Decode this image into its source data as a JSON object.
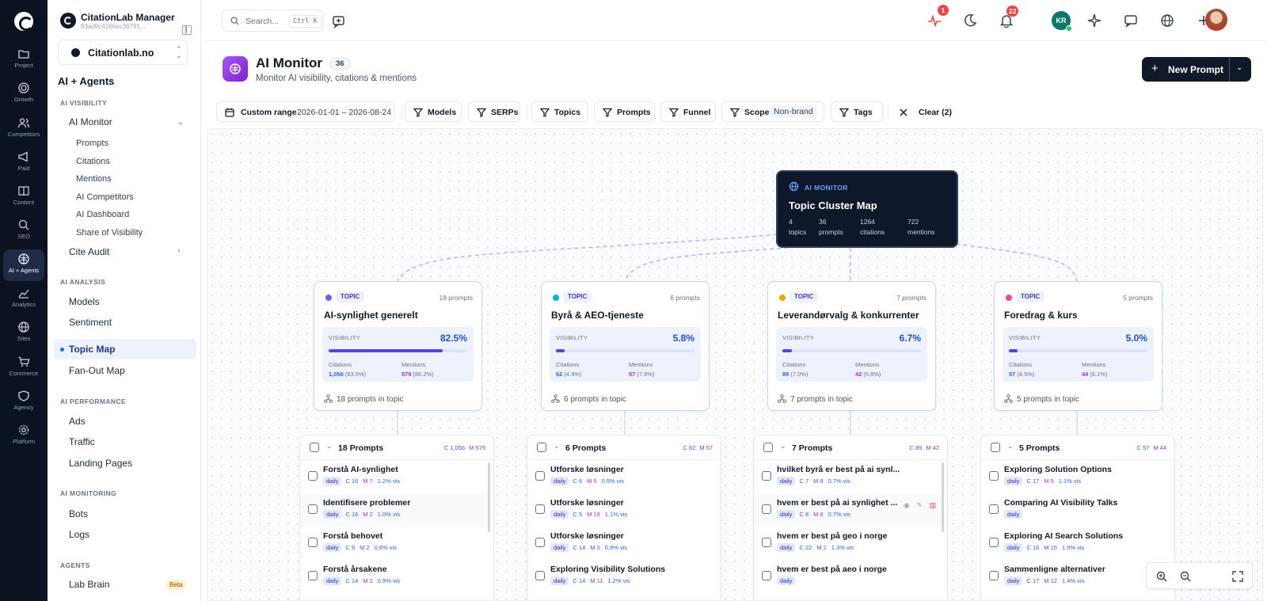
{
  "rail": [
    {
      "label": "Project",
      "icon": "folder-icon"
    },
    {
      "label": "Growth",
      "icon": "target-icon"
    },
    {
      "label": "Competitors",
      "icon": "users-icon"
    },
    {
      "label": "Paid",
      "icon": "megaphone-icon"
    },
    {
      "label": "Content",
      "icon": "book-icon"
    },
    {
      "label": "SEO",
      "icon": "search-icon"
    },
    {
      "label": "AI + Agents",
      "icon": "ai-icon"
    },
    {
      "label": "Analytics",
      "icon": "chart-icon"
    },
    {
      "label": "Sites",
      "icon": "globe-icon"
    },
    {
      "label": "Commerce",
      "icon": "cart-icon"
    },
    {
      "label": "Agency",
      "icon": "handshake-icon"
    },
    {
      "label": "Platform",
      "icon": "gear-icon"
    }
  ],
  "brand": {
    "name": "CitationLab Manager",
    "id": "93ad9c4166ec36791..."
  },
  "workspace": "Citationlab.no",
  "section": "AI + Agents",
  "nav": {
    "ai_visibility": "AI VISIBILITY",
    "ai_monitor": "AI Monitor",
    "monitor_subs": [
      "Prompts",
      "Citations",
      "Mentions",
      "AI Competitors",
      "AI Dashboard",
      "Share of Visibility"
    ],
    "cite_audit": "Cite Audit",
    "ai_analysis": "AI ANALYSIS",
    "models": "Models",
    "sentiment": "Sentiment",
    "topic_map": "Topic Map",
    "fanout": "Fan-Out Map",
    "ai_performance": "AI PERFORMANCE",
    "ads": "Ads",
    "traffic": "Traffic",
    "landing": "Landing Pages",
    "ai_monitoring": "AI MONITORING",
    "bots": "Bots",
    "logs": "Logs",
    "agents": "AGENTS",
    "lab_brain": "Lab Brain",
    "beta": "Beta"
  },
  "topbar": {
    "search_placeholder": "Search...",
    "shortcut": "Ctrl K",
    "activity_badge": "1",
    "notif_badge": "22",
    "avatar_initials": "KR"
  },
  "page": {
    "title": "AI Monitor",
    "count": "36",
    "subtitle": "Monitor AI visibility, citations & mentions",
    "new_prompt": "New Prompt"
  },
  "filters": {
    "range_label": "Custom range",
    "range_value": "2026-01-01 – 2026-08-24",
    "models": "Models",
    "serps": "SERPs",
    "topics": "Topics",
    "prompts": "Prompts",
    "funnel": "Funnel",
    "scope": "Scope",
    "scope_value": "Non-brand",
    "tags": "Tags",
    "clear": "Clear (2)"
  },
  "root": {
    "tag": "AI MONITOR",
    "title": "Topic Cluster Map",
    "stats": [
      {
        "v": "4",
        "l": "topics"
      },
      {
        "v": "36",
        "l": "prompts"
      },
      {
        "v": "1264",
        "l": "citations"
      },
      {
        "v": "722",
        "l": "mentions"
      }
    ]
  },
  "topics": [
    {
      "tag": "TOPIC",
      "dot": "#6366f1",
      "count": "18 prompts",
      "name": "AI-synlighet generelt",
      "vis_label": "VISIBILITY",
      "vis": "82.5%",
      "fill": 0.825,
      "cit_label": "Citations",
      "cit": "1,056",
      "cit_pct": "(83.5%)",
      "men_label": "Mentions",
      "men": "579",
      "men_pct": "(80.2%)",
      "footer": "18 prompts in topic",
      "list": {
        "header": "18 Prompts",
        "c": "C 1,056",
        "m": "M 579",
        "rows": [
          {
            "title": "Forstå AI-synlighet",
            "freq": "daily",
            "c": "C 16",
            "m": "M 7",
            "v": "1.2% vis"
          },
          {
            "title": "Identifisere problemer",
            "freq": "daily",
            "c": "C 16",
            "m": "M 2",
            "v": "1.0% vis"
          },
          {
            "title": "Forstå behovet",
            "freq": "daily",
            "c": "C 9",
            "m": "M 2",
            "v": "0.6% vis"
          },
          {
            "title": "Forstå årsakene",
            "freq": "daily",
            "c": "C 14",
            "m": "M 2",
            "v": "0.9% vis"
          }
        ]
      }
    },
    {
      "tag": "TOPIC",
      "dot": "#06b6d4",
      "count": "6 prompts",
      "name": "Byrå & AEO-tjeneste",
      "vis_label": "VISIBILITY",
      "vis": "5.8%",
      "fill": 0.058,
      "cit_label": "Citations",
      "cit": "62",
      "cit_pct": "(4.9%)",
      "men_label": "Mentions",
      "men": "57",
      "men_pct": "(7.9%)",
      "footer": "6 prompts in topic",
      "list": {
        "header": "6 Prompts",
        "c": "C 62",
        "m": "M 57",
        "rows": [
          {
            "title": "Utforske løsninger",
            "freq": "daily",
            "c": "C 6",
            "m": "M 5",
            "v": "0.5% vis"
          },
          {
            "title": "Utforske løsninger",
            "freq": "daily",
            "c": "C 5",
            "m": "M 19",
            "v": "1.1% vis"
          },
          {
            "title": "Utforske løsninger",
            "freq": "daily",
            "c": "C 14",
            "m": "M 3",
            "v": "0.9% vis"
          },
          {
            "title": "Exploring Visibility Solutions",
            "freq": "daily",
            "c": "C 14",
            "m": "M 11",
            "v": "1.2% vis"
          }
        ]
      }
    },
    {
      "tag": "TOPIC",
      "dot": "#f59e0b",
      "count": "7 prompts",
      "name": "Leverandørvalg & konkurrenter",
      "vis_label": "VISIBILITY",
      "vis": "6.7%",
      "fill": 0.067,
      "cit_label": "Citations",
      "cit": "89",
      "cit_pct": "(7.0%)",
      "men_label": "Mentions",
      "men": "42",
      "men_pct": "(5.8%)",
      "footer": "7 prompts in topic",
      "list": {
        "header": "7 Prompts",
        "c": "C 89",
        "m": "M 42",
        "rows": [
          {
            "title": "hvilket byrå er best på ai synl...",
            "freq": "daily",
            "c": "C 7",
            "m": "M 8",
            "v": "0.7% vis"
          },
          {
            "title": "hvem er best på ai synlighet ...",
            "freq": "daily",
            "c": "C 8",
            "m": "M 6",
            "v": "0.7% vis"
          },
          {
            "title": "hvem er best på geo i norge",
            "freq": "daily",
            "c": "C 22",
            "m": "M 2",
            "v": "1.3% vis"
          },
          {
            "title": "hvem er best på aeo i norge",
            "freq": "daily",
            "c": "",
            "m": "",
            "v": ""
          }
        ]
      }
    },
    {
      "tag": "TOPIC",
      "dot": "#ec4899",
      "count": "5 prompts",
      "name": "Foredrag & kurs",
      "vis_label": "VISIBILITY",
      "vis": "5.0%",
      "fill": 0.05,
      "cit_label": "Citations",
      "cit": "57",
      "cit_pct": "(4.5%)",
      "men_label": "Mentions",
      "men": "44",
      "men_pct": "(6.1%)",
      "footer": "5 prompts in topic",
      "list": {
        "header": "5 Prompts",
        "c": "C 57",
        "m": "M 44",
        "rows": [
          {
            "title": "Exploring Solution Options",
            "freq": "daily",
            "c": "C 17",
            "m": "M 5",
            "v": "1.1% vis"
          },
          {
            "title": "Comparing AI Visibility Talks",
            "freq": "daily",
            "c": "",
            "m": "",
            "v": ""
          },
          {
            "title": "Exploring AI Search Solutions",
            "freq": "daily",
            "c": "C 16",
            "m": "M 15",
            "v": "1.5% vis"
          },
          {
            "title": "Sammenligne alternativer",
            "freq": "daily",
            "c": "C 17",
            "m": "M 12",
            "v": "1.4% vis"
          }
        ]
      }
    }
  ]
}
